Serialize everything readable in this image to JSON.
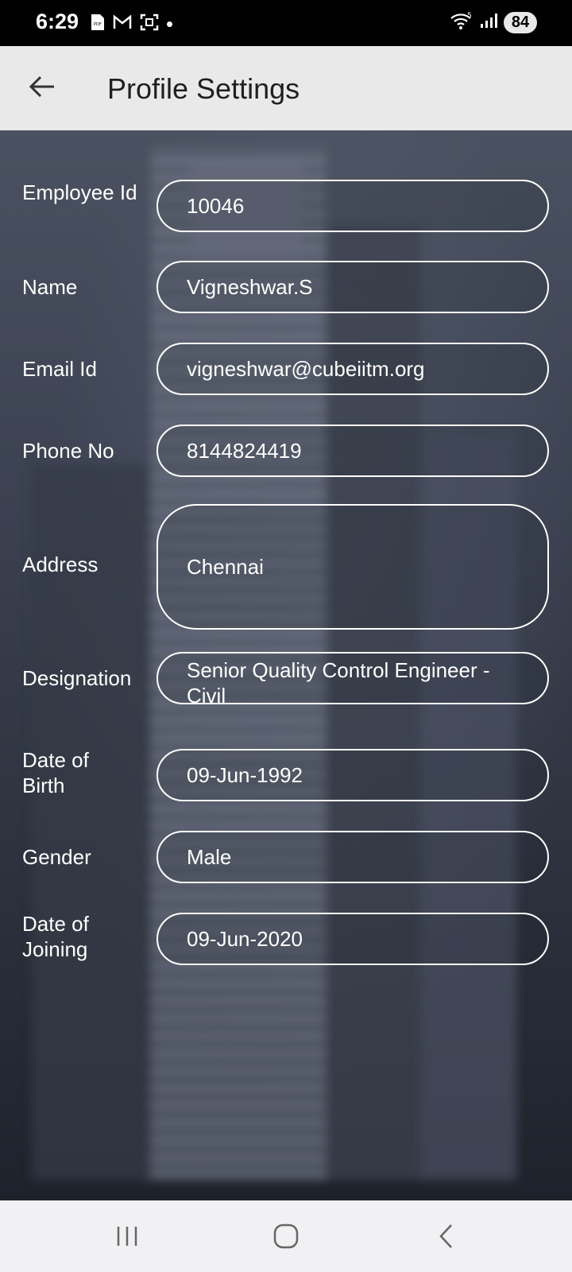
{
  "status_bar": {
    "time": "6:29",
    "battery": "84",
    "left_icons": [
      "pdf-icon",
      "gmail-icon",
      "screenshot-icon",
      "dot-icon"
    ],
    "right_icons": [
      "wifi-icon",
      "signal-icon"
    ]
  },
  "app_bar": {
    "title": "Profile Settings"
  },
  "fields": [
    {
      "label": "Employee Id",
      "value": "10046"
    },
    {
      "label": "Name",
      "value": "Vigneshwar.S"
    },
    {
      "label": "Email Id",
      "value": "vigneshwar@cubeiitm.org"
    },
    {
      "label": "Phone No",
      "value": "8144824419"
    },
    {
      "label": "Address",
      "value": "Chennai"
    },
    {
      "label": "Designation",
      "value": "Senior Quality Control Engineer - Civil"
    },
    {
      "label": "Date of Birth",
      "value": "09-Jun-1992"
    },
    {
      "label": "Gender",
      "value": "Male"
    },
    {
      "label": "Date of Joining",
      "value": "09-Jun-2020"
    }
  ],
  "colors": {
    "status_bar": "#000000",
    "app_bar": "#e9e9e9",
    "field_border": "#ffffff",
    "nav_bar": "#f1f1f3"
  }
}
